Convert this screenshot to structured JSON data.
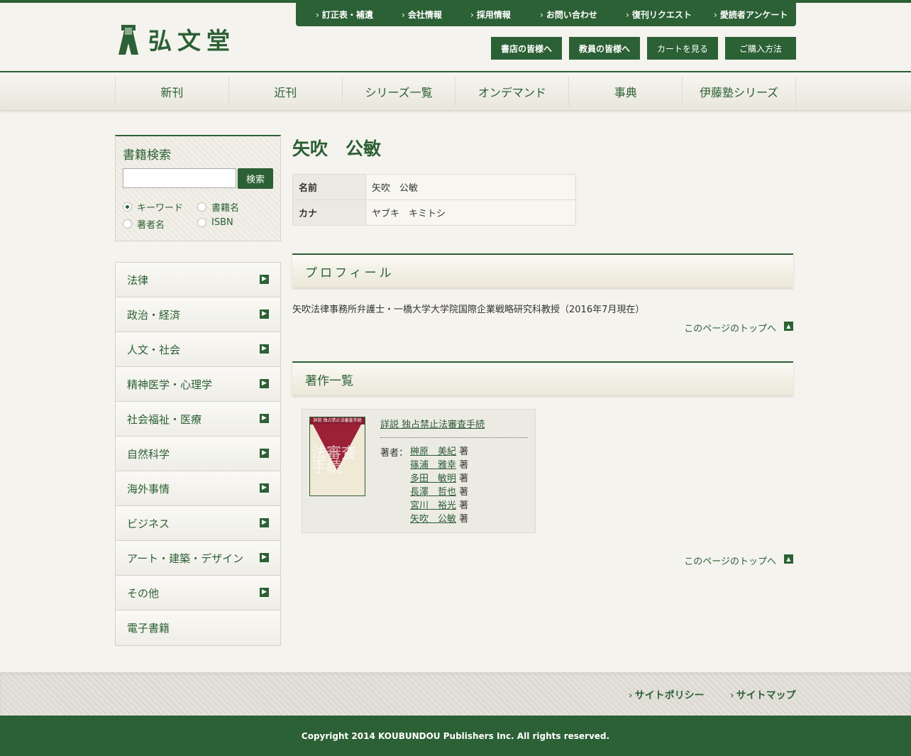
{
  "header": {
    "logo_text": "弘文堂",
    "util_links": [
      "訂正表・補遺",
      "会社情報",
      "採用情報",
      "お問い合わせ",
      "復刊リクエスト",
      "愛読者アンケート"
    ],
    "buttons": [
      "書店の皆様へ",
      "教員の皆様へ",
      "カートを見る",
      "ご購入方法"
    ]
  },
  "nav": [
    "新刊",
    "近刊",
    "シリーズ一覧",
    "オンデマンド",
    "事典",
    "伊藤塾シリーズ"
  ],
  "search": {
    "title": "書籍検索",
    "input_value": "",
    "button": "検索",
    "options": [
      "キーワード",
      "書籍名",
      "著者名",
      "ISBN"
    ],
    "selected": "キーワード"
  },
  "categories": [
    "法律",
    "政治・経済",
    "人文・社会",
    "精神医学・心理学",
    "社会福祉・医療",
    "自然科学",
    "海外事情",
    "ビジネス",
    "アート・建築・デザイン",
    "その他",
    "電子書籍"
  ],
  "page": {
    "title": "矢吹　公敏",
    "info": [
      {
        "key": "名前",
        "value": "矢吹　公敏"
      },
      {
        "key": "カナ",
        "value": "ヤブキ　キミトシ"
      }
    ],
    "profile_heading": "プロフィール",
    "profile_text": "矢吹法律事務所弁護士・一橋大学大学院国際企業戦略研究科教授（2016年7月現在）",
    "to_top": "このページのトップへ",
    "works_heading": "著作一覧"
  },
  "book": {
    "title": "詳説 独占禁止法審査手続",
    "cover_band": "詳説 独占禁止法審査手続",
    "cover_text": "法審査手続",
    "authors_label": "著者：",
    "authors": [
      "榊原　美紀",
      "篠浦　雅幸",
      "多田　敏明",
      "長澤　哲也",
      "宮川　裕光",
      "矢吹　公敏"
    ],
    "role": "著"
  },
  "footer": {
    "links": [
      "サイトポリシー",
      "サイトマップ"
    ],
    "copyright": "Copyright 2014 KOUBUNDOU Publishers Inc. All rights reserved."
  },
  "colors": {
    "brand": "#2c6035",
    "background": "#f4f3ee"
  }
}
